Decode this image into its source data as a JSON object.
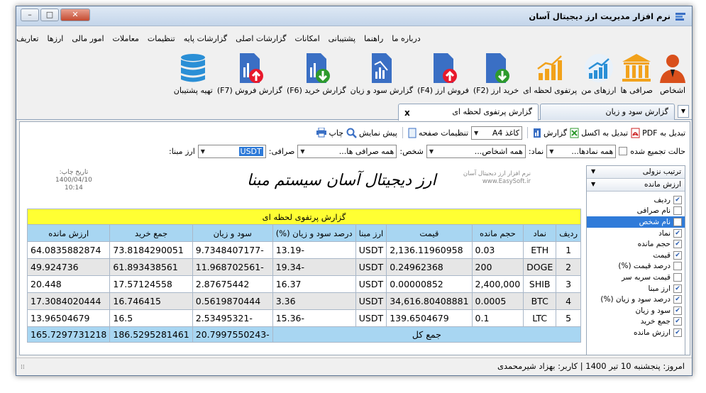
{
  "window": {
    "title": "نرم افزار مدیریت ارز دیجیتال آسان"
  },
  "menu": [
    "تعاریف",
    "ارزها",
    "امور مالی",
    "معاملات",
    "تنظیمات",
    "گزارشات پایه",
    "گزارشات اصلی",
    "امکانات",
    "پشتیبانی",
    "راهنما",
    "درباره ما"
  ],
  "ribbon": [
    {
      "label": "اشخاص",
      "icon": "person-icon"
    },
    {
      "label": "صرافی ها",
      "icon": "bank-icon"
    },
    {
      "label": "ارزهای من",
      "icon": "chart-up-icon"
    },
    {
      "label": "پرتفوی لحظه ای",
      "icon": "bar-chart-icon"
    },
    {
      "label": "خرید ارز (F2)",
      "icon": "document-download-icon"
    },
    {
      "label": "فروش ارز (F4)",
      "icon": "document-upload-icon"
    },
    {
      "label": "گزارش سود و زیان",
      "icon": "report-icon"
    },
    {
      "label": "گزارش خرید (F6)",
      "icon": "report-download-icon"
    },
    {
      "label": "گزارش فروش (F7)",
      "icon": "report-upload-icon"
    },
    {
      "label": "تهیه پشتیبان",
      "icon": "database-icon"
    }
  ],
  "tabs": [
    {
      "label": "گزارش سود و زیان"
    },
    {
      "label": "گزارش پرتفوی لحظه ای"
    }
  ],
  "toolbar": {
    "print": "چاپ",
    "preview": "پیش نمایش",
    "page_settings": "تنظیمات صفحه",
    "paper": "کاغذ A4",
    "report": "گزارش",
    "excel": "تبدیل به اکسل",
    "pdf": "تبدیل به PDF"
  },
  "filters": {
    "base_label": "ارز مبنا:",
    "base_value": "USDT",
    "exchange_label": "صرافی:",
    "exchange_value": "همه صرافی ها...",
    "person_label": "شخص:",
    "person_value": "همه اشخاص...",
    "symbol_label": "نماد:",
    "symbol_value": "همه نمادها...",
    "aggregate_label": "حالت تجمیع شده"
  },
  "report": {
    "company_line1": "نرم افزار ارز دیجیتال آسان",
    "company_line2": "www.EasySoft.ir",
    "heading": "ارز دیجیتال آسان سیستم مبنا",
    "print_date_label": "تاریخ چاپ:",
    "print_date": "1400/04/10",
    "print_time": "10:14",
    "caption": "گزارش پرتفوی لحظه ای",
    "columns": [
      "ردیف",
      "نماد",
      "حجم مانده",
      "قیمت",
      "ارز مبنا",
      "درصد سود و زیان (%)",
      "سود و زیان",
      "جمع خرید",
      "ارزش مانده"
    ],
    "rows": [
      [
        "1",
        "ETH",
        "0.03",
        "2,136.11960958",
        "USDT",
        "-13.19",
        "-9.7348407177",
        "73.8184290051",
        "64.0835882874"
      ],
      [
        "2",
        "DOGE",
        "200",
        "0.24962368",
        "USDT",
        "-19.34",
        "-11.968702561",
        "61.893438561",
        "49.924736"
      ],
      [
        "3",
        "SHIB",
        "2,400,000",
        "0.00000852",
        "USDT",
        "16.37",
        "2.87675442",
        "17.57124558",
        "20.448"
      ],
      [
        "4",
        "BTC",
        "0.0005",
        "34,616.80408881",
        "USDT",
        "3.36",
        "0.5619870444",
        "16.746415",
        "17.3084020444"
      ],
      [
        "5",
        "LTC",
        "0.1",
        "139.6504679",
        "USDT",
        "-15.36",
        "-2.53495321",
        "16.5",
        "13.96504679"
      ]
    ],
    "total_label": "جمع کل",
    "total_profit": "-20.7997550243",
    "total_buy": "186.5295281461",
    "total_value": "165.7297731218"
  },
  "sidebar": {
    "sort_label": "ترتیب نزولی",
    "group_label": "ارزش مانده",
    "items": [
      {
        "label": "ردیف",
        "checked": true
      },
      {
        "label": "نام صرافی",
        "checked": false
      },
      {
        "label": "نام شخص",
        "checked": false
      },
      {
        "label": "نماد",
        "checked": true
      },
      {
        "label": "حجم مانده",
        "checked": true
      },
      {
        "label": "قیمت",
        "checked": true
      },
      {
        "label": "درصد قیمت (%)",
        "checked": false
      },
      {
        "label": "قیمت سربه سر",
        "checked": false
      },
      {
        "label": "ارز مبنا",
        "checked": true
      },
      {
        "label": "درصد سود و زیان (%)",
        "checked": true
      },
      {
        "label": "سود و زیان",
        "checked": true
      },
      {
        "label": "جمع خرید",
        "checked": true
      },
      {
        "label": "ارزش مانده",
        "checked": true
      }
    ]
  },
  "status": {
    "text": "امروز: پنجشنبه 10 تیر 1400  |  کاربر: بهزاد شیرمحمدی"
  },
  "colors": {
    "accent": "#2f7bd9",
    "header": "#a8d6f2",
    "caption": "#ffff33",
    "red": "#e8192c",
    "green": "#2d9a2d",
    "blue": "#3a6fc4"
  }
}
